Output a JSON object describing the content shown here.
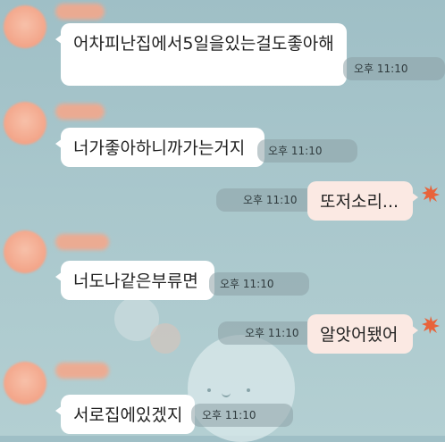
{
  "colors": {
    "background": "#a9c7cc",
    "bubble_received": "#ffffff",
    "bubble_sent": "#fbe9e3",
    "avatar": "#f3a488",
    "burst": "#e8633a"
  },
  "messages": [
    {
      "side": "received",
      "text": "어차피난집에서5일을있는걸도좋아해",
      "time": "오후 11:10"
    },
    {
      "side": "received",
      "text": "너가좋아하니까가는거지",
      "time": "오후 11:10"
    },
    {
      "side": "sent",
      "text": "또저소리...",
      "time": "오후 11:10"
    },
    {
      "side": "received",
      "text": "너도나같은부류면",
      "time": "오후 11:10"
    },
    {
      "side": "sent",
      "text": "알앗어됐어",
      "time": "오후 11:10"
    },
    {
      "side": "received",
      "text": "서로집에있겠지",
      "time": "오후 11:10"
    }
  ]
}
